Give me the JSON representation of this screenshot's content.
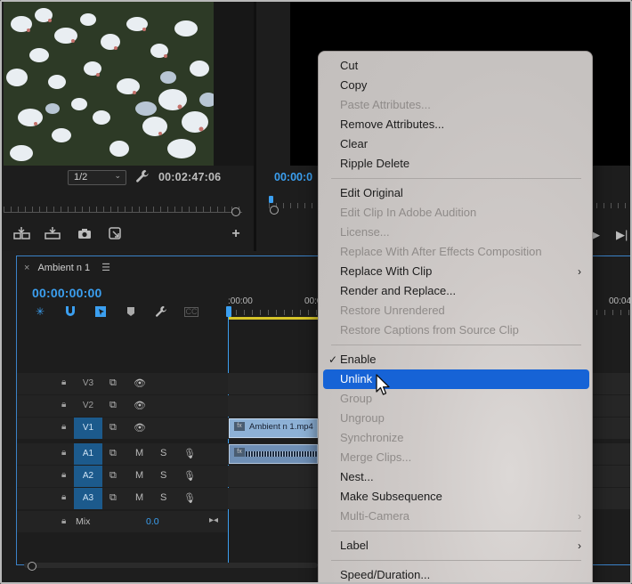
{
  "source_monitor": {
    "resolution": "1/2",
    "timecode": "00:02:47:06"
  },
  "program_monitor": {
    "timecode": "00:00:0"
  },
  "timeline": {
    "tab_title": "Ambient n 1",
    "timecode": "00:00:00:00",
    "ruler_labels": [
      ":00:00",
      "00:0",
      "00:04"
    ],
    "tracks": [
      {
        "name": "V3",
        "targeted": false,
        "type": "video"
      },
      {
        "name": "V2",
        "targeted": false,
        "type": "video"
      },
      {
        "name": "V1",
        "targeted": true,
        "type": "video"
      },
      {
        "name": "A1",
        "targeted": true,
        "type": "audio"
      },
      {
        "name": "A2",
        "targeted": true,
        "type": "audio"
      },
      {
        "name": "A3",
        "targeted": true,
        "type": "audio"
      }
    ],
    "audio_buttons": {
      "mute": "M",
      "solo": "S"
    },
    "mix_label": "Mix",
    "mix_value": "0.0",
    "video_clip_name": "Ambient n 1.mp4"
  },
  "context_menu": {
    "items": [
      {
        "label": "Cut",
        "enabled": true
      },
      {
        "label": "Copy",
        "enabled": true
      },
      {
        "label": "Paste Attributes...",
        "enabled": false
      },
      {
        "label": "Remove Attributes...",
        "enabled": true
      },
      {
        "label": "Clear",
        "enabled": true
      },
      {
        "label": "Ripple Delete",
        "enabled": true
      },
      {
        "separator": true
      },
      {
        "label": "Edit Original",
        "enabled": true
      },
      {
        "label": "Edit Clip In Adobe Audition",
        "enabled": false
      },
      {
        "label": "License...",
        "enabled": false
      },
      {
        "label": "Replace With After Effects Composition",
        "enabled": false
      },
      {
        "label": "Replace With Clip",
        "enabled": true,
        "submenu": true
      },
      {
        "label": "Render and Replace...",
        "enabled": true
      },
      {
        "label": "Restore Unrendered",
        "enabled": false
      },
      {
        "label": "Restore Captions from Source Clip",
        "enabled": false
      },
      {
        "separator": true
      },
      {
        "label": "Enable",
        "enabled": true,
        "checked": true
      },
      {
        "label": "Unlink",
        "enabled": true,
        "highlighted": true
      },
      {
        "label": "Group",
        "enabled": false
      },
      {
        "label": "Ungroup",
        "enabled": false
      },
      {
        "label": "Synchronize",
        "enabled": false
      },
      {
        "label": "Merge Clips...",
        "enabled": false
      },
      {
        "label": "Nest...",
        "enabled": true
      },
      {
        "label": "Make Subsequence",
        "enabled": true
      },
      {
        "label": "Multi-Camera",
        "enabled": false,
        "submenu": true
      },
      {
        "separator": true
      },
      {
        "label": "Label",
        "enabled": true,
        "submenu": true
      },
      {
        "separator": true
      },
      {
        "label": "Speed/Duration...",
        "enabled": true
      }
    ]
  },
  "colors": {
    "accent_blue": "#3b9ff0",
    "menu_highlight": "#1663d6",
    "track_target": "#1c5a8c",
    "clip_video": "#8db1d6",
    "in_out_bar": "#d6c429"
  }
}
